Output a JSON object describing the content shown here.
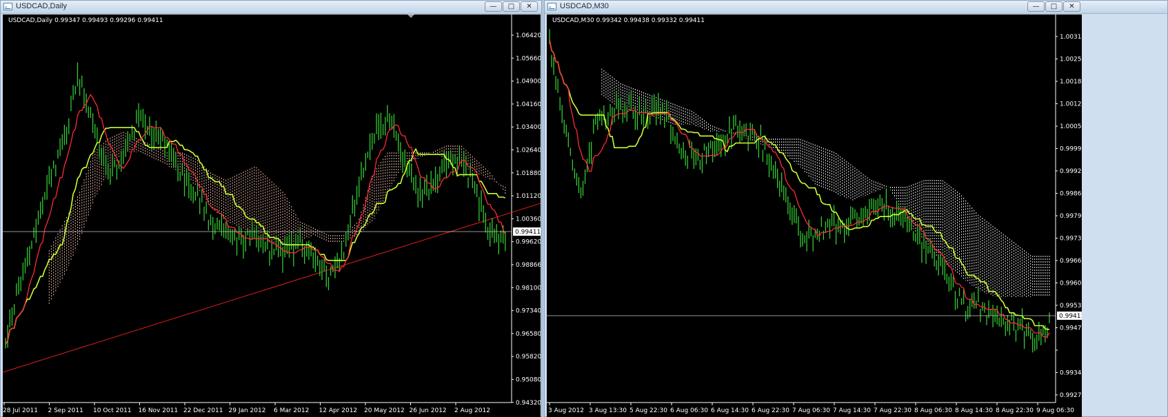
{
  "windows": {
    "daily": {
      "title": "USDCAD,Daily",
      "info": "USDCAD,Daily  0.99347 0.99493 0.99296 0.99411",
      "price_labels": [
        "1.06420",
        "1.05660",
        "1.04900",
        "1.04160",
        "1.03400",
        "1.02640",
        "1.01880",
        "1.01120",
        "1.00360",
        "0.99620",
        "0.98866",
        "0.98100",
        "0.97340",
        "0.96580",
        "0.95820",
        "0.95080",
        "0.94320"
      ],
      "current_price": "0.99411",
      "date_labels": [
        "28 Jul 2011",
        "2 Sep 2011",
        "10 Oct 2011",
        "16 Nov 2011",
        "22 Dec 2011",
        "29 Jan 2012",
        "6 Mar 2012",
        "12 Apr 2012",
        "20 May 2012",
        "26 Jun 2012",
        "2 Aug 2012"
      ]
    },
    "m30": {
      "title": "USDCAD,M30",
      "info": "USDCAD,M30  0.99342 0.99438 0.99332 0.99411",
      "price_labels": [
        "1.00315",
        "1.00250",
        "1.00185",
        "1.00120",
        "1.00055",
        "0.99990",
        "0.99925",
        "0.99860",
        "0.99795",
        "0.99730",
        "0.99665",
        "0.99600",
        "0.99535",
        "0.99470",
        "0.99411",
        "0.99340",
        "0.99275"
      ],
      "current_price": "0.99411",
      "date_labels": [
        "3 Aug 2012",
        "3 Aug 13:30",
        "5 Aug 22:30",
        "6 Aug 06:30",
        "6 Aug 14:30",
        "6 Aug 22:30",
        "7 Aug 06:30",
        "7 Aug 14:30",
        "7 Aug 22:30",
        "8 Aug 06:30",
        "8 Aug 14:30",
        "8 Aug 22:30",
        "9 Aug 06:30"
      ]
    }
  },
  "controls": {
    "minimize": "—",
    "maximize": "□",
    "close": "✕"
  },
  "colors": {
    "bull": "#33cc33",
    "tenkan": "#ff2a3a",
    "kijun": "#ccff33",
    "cloud_daily": "#e8b8a8",
    "cloud_m30": "#e6e6e6",
    "trendline": "#e0201c",
    "bg": "#000000"
  }
}
